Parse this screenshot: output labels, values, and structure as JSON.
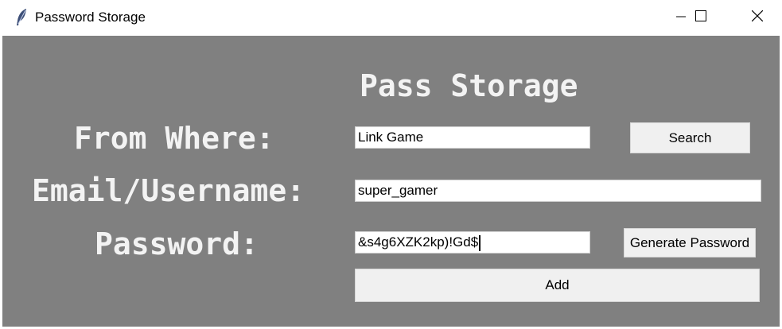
{
  "window": {
    "title": "Password Storage",
    "icon": "feather-icon",
    "controls": [
      "minimize-icon",
      "maximize-icon",
      "close-icon"
    ]
  },
  "app": {
    "heading": "Pass Storage",
    "labels": {
      "from_where": "From Where:",
      "email": "Email/Username:",
      "password": "Password:"
    },
    "fields": {
      "from_where": "Link Game",
      "email": "super_gamer",
      "password": "&s4g6XZK2kp)!Gd$"
    },
    "buttons": {
      "search": "Search",
      "generate": "Generate Password",
      "add": "Add"
    }
  },
  "colors": {
    "background": "#808080",
    "label_text": "#f3f3f3",
    "button_bg": "#f0f0f0",
    "field_bg": "#ffffff"
  }
}
